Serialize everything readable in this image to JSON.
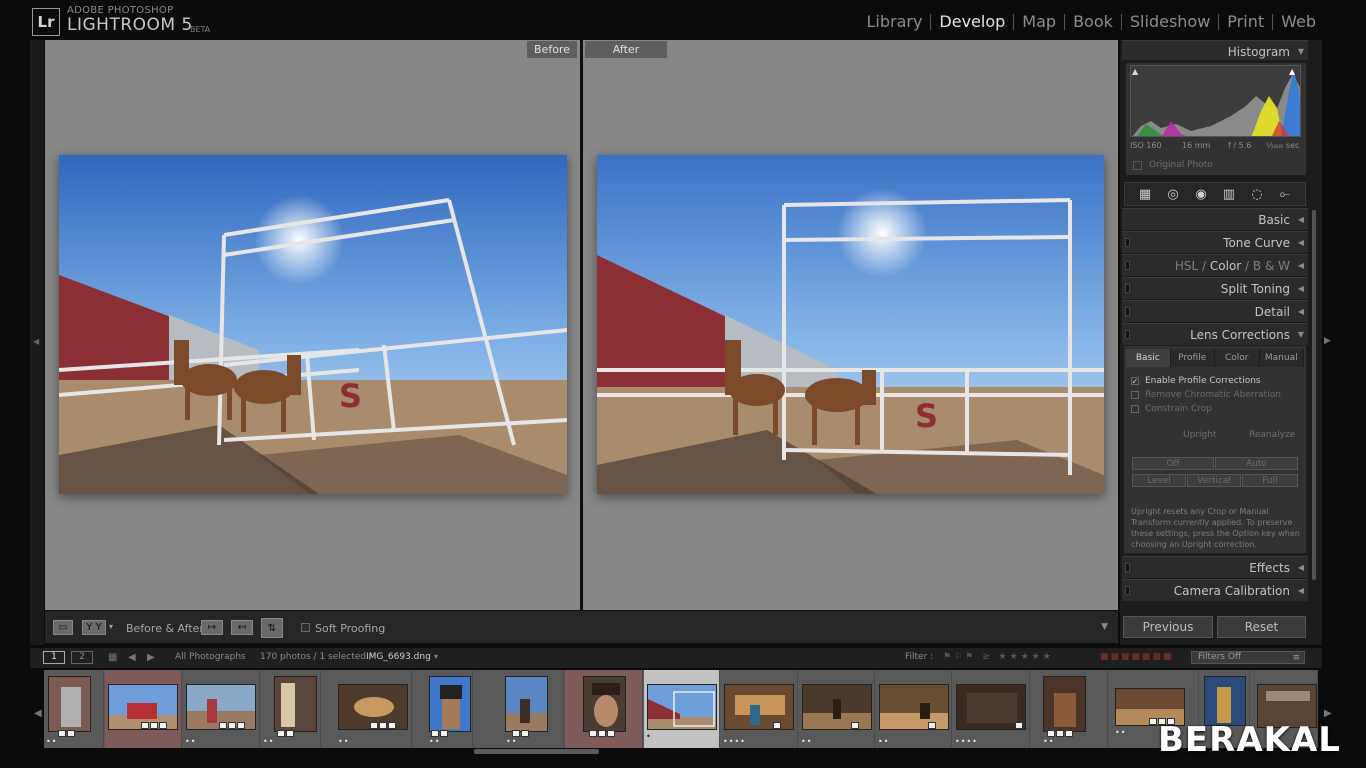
{
  "app": {
    "badge": "Lr",
    "brand_line1": "ADOBE PHOTOSHOP",
    "brand_line2": "LIGHTROOM 5",
    "brand_tag": "BETA"
  },
  "modules": [
    "Library",
    "Develop",
    "Map",
    "Book",
    "Slideshow",
    "Print",
    "Web"
  ],
  "active_module": "Develop",
  "canvas": {
    "before_label": "Before",
    "after_label": "After"
  },
  "toolbar": {
    "view_yy": "Y Y",
    "before_after_label": "Before & After :",
    "soft_proofing": "Soft Proofing"
  },
  "histogram": {
    "title": "Histogram",
    "iso": "ISO 160",
    "focal": "16 mm",
    "aperture": "f / 5.6",
    "shutter": "¹⁄₁₆₀₀ sec",
    "original_photo": "Original Photo"
  },
  "panels": {
    "basic": "Basic",
    "tone_curve": "Tone Curve",
    "hsl": "HSL",
    "color": "Color",
    "bw": "B & W",
    "split_toning": "Split Toning",
    "detail": "Detail",
    "lens_corrections": "Lens Corrections",
    "effects": "Effects",
    "camera_calibration": "Camera Calibration"
  },
  "lens": {
    "tabs": [
      "Basic",
      "Profile",
      "Color",
      "Manual"
    ],
    "active_tab": "Basic",
    "enable_profile": "Enable Profile Corrections",
    "remove_ca": "Remove Chromatic Aberration",
    "constrain_crop": "Constrain Crop",
    "upright_label": "Upright",
    "reanalyze": "Reanalyze",
    "off": "Off",
    "auto": "Auto",
    "level": "Level",
    "vertical": "Vertical",
    "full": "Full",
    "note": "Upright resets any Crop or Manual Transform currently applied. To preserve these settings, press the Option key when choosing an Upright correction."
  },
  "buttons": {
    "previous": "Previous",
    "reset": "Reset"
  },
  "filmstrip": {
    "page1": "1",
    "page2": "2",
    "source": "All Photographs",
    "count": "170 photos / 1 selected /",
    "filename": "IMG_6693.dng",
    "filter_label": "Filter :",
    "filters_off": "Filters Off"
  },
  "watermark": "BERAKAL",
  "colors": {
    "canvas_gray": "#878787",
    "sky": "#5b8fd6",
    "barn_red": "#8c2f34",
    "dirt": "#a98b6e"
  }
}
